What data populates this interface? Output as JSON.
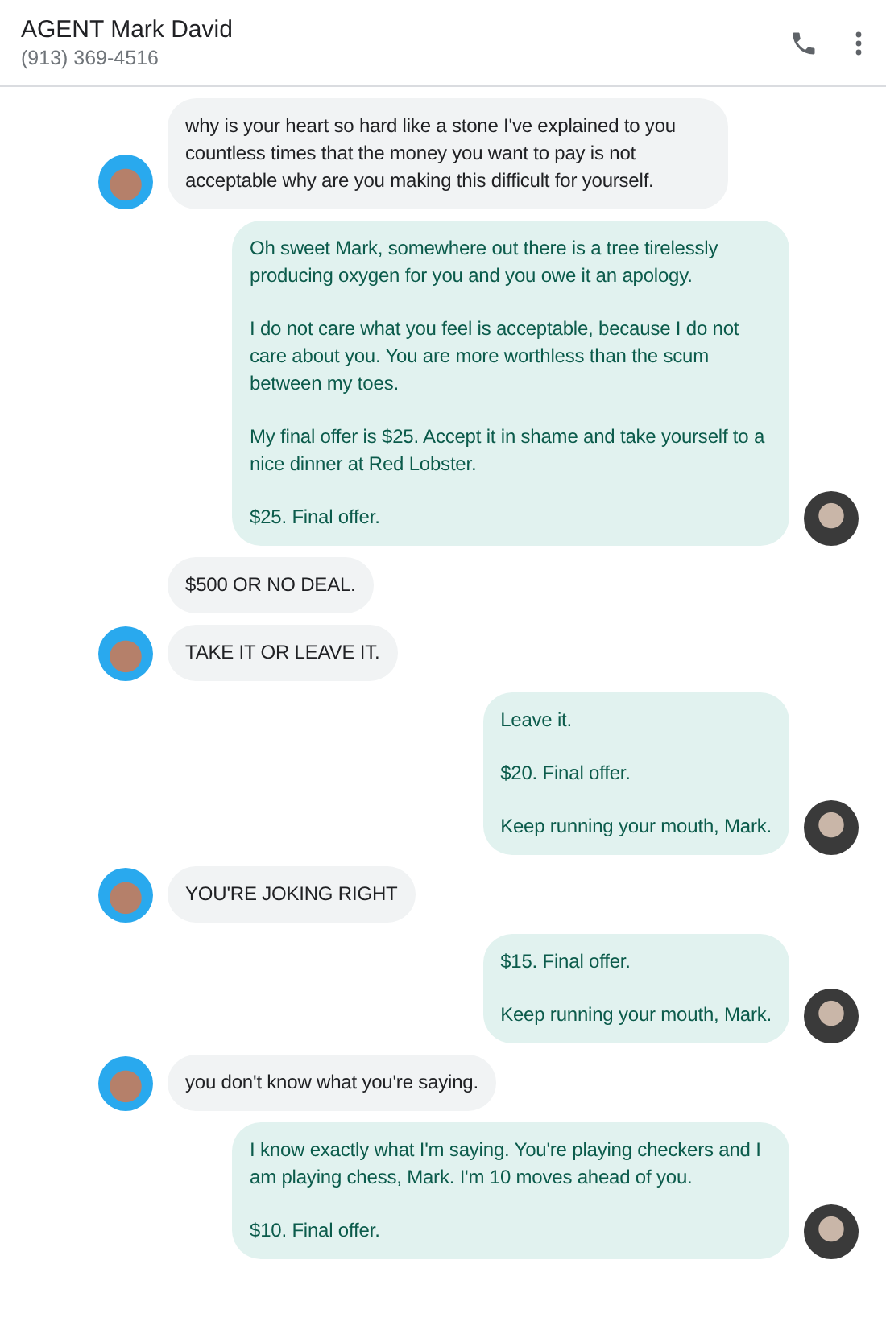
{
  "header": {
    "title": "AGENT Mark David",
    "subtitle": "(913) 369-4516"
  },
  "groups": [
    {
      "kind": "incoming",
      "bubbles": [
        [
          "why is your heart so hard like a stone I've explained to you countless times that the money you want to pay is not acceptable why are you making this difficult for yourself."
        ]
      ]
    },
    {
      "kind": "outgoing",
      "bubbles": [
        [
          "Oh sweet Mark, somewhere out there is a tree tirelessly producing oxygen for you and you owe it an apology.",
          "I do not care what you feel is acceptable, because I do not care about you. You are more worthless than the scum between my toes.",
          "My final offer is $25. Accept it in shame and take yourself to a nice dinner at Red Lobster.",
          "$25. Final offer."
        ]
      ]
    },
    {
      "kind": "incoming",
      "bubbles": [
        [
          "$500 OR NO DEAL."
        ],
        [
          "TAKE IT OR LEAVE IT."
        ]
      ]
    },
    {
      "kind": "outgoing",
      "bubbles": [
        [
          "Leave it.",
          "$20. Final offer.",
          "Keep running your mouth, Mark."
        ]
      ]
    },
    {
      "kind": "incoming",
      "bubbles": [
        [
          "YOU'RE JOKING RIGHT"
        ]
      ]
    },
    {
      "kind": "outgoing",
      "bubbles": [
        [
          "$15. Final offer.",
          "Keep running your mouth, Mark."
        ]
      ]
    },
    {
      "kind": "incoming",
      "bubbles": [
        [
          "you don't know what you're saying."
        ]
      ]
    },
    {
      "kind": "outgoing",
      "bubbles": [
        [
          "I know exactly what I'm saying. You're playing checkers and I am playing chess, Mark. I'm 10 moves ahead of you.",
          "$10. Final offer."
        ]
      ]
    }
  ]
}
